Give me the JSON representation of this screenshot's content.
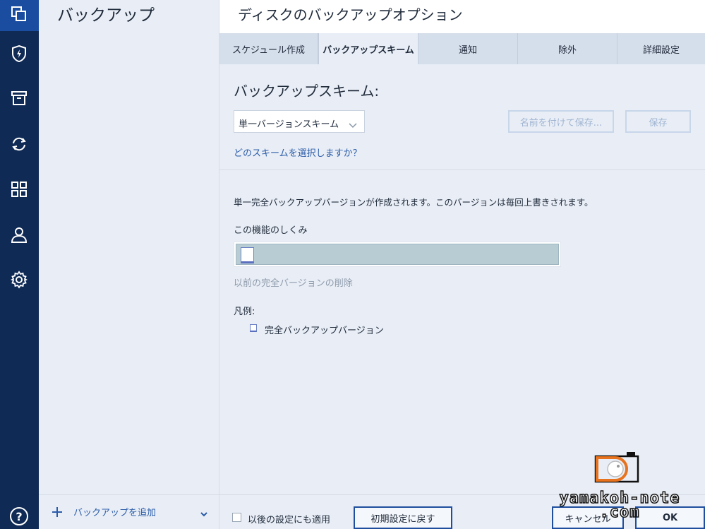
{
  "nav": {
    "icons": [
      "copy-icon",
      "shield-bolt-icon",
      "archive-icon",
      "sync-icon",
      "grid-icon",
      "user-icon",
      "gear-icon",
      "help-icon"
    ],
    "help_glyph": "?"
  },
  "sidebar": {
    "title": "バックアップ",
    "add_label": "バックアップを追加"
  },
  "dialog": {
    "title": "ディスクのバックアップオプション",
    "tabs": [
      {
        "label": "スケジュール作成",
        "active": false
      },
      {
        "label": "バックアップスキーム",
        "active": true
      },
      {
        "label": "通知",
        "active": false
      },
      {
        "label": "除外",
        "active": false
      },
      {
        "label": "詳細設定",
        "active": false
      }
    ],
    "section_title": "バックアップスキーム:",
    "scheme_select": {
      "value": "単一バージョンスキーム"
    },
    "save_as_label": "名前を付けて保存...",
    "save_label": "保存",
    "help_link": "どのスキームを選択しますか？",
    "description": "単一完全バックアップバージョンが作成されます。このバージョンは毎回上書きされます。",
    "how_it_works": "この機能のしくみ",
    "deletion_label": "以前の完全バージョンの削除",
    "legend_label": "凡例:",
    "legend_item": "完全バックアップバージョン"
  },
  "footer": {
    "apply_label": "以後の設定にも適用",
    "reset_label": "初期設定に戻す",
    "cancel_label": "キャンセル",
    "ok_label": "OK"
  },
  "watermark": {
    "line1": "yamakoh-note",
    "line2": ".com"
  },
  "colors": {
    "rail": "#0f2a55",
    "rail_active": "#1a4da0",
    "accent": "#2b5ca8",
    "button_border": "#1f4e9e"
  }
}
